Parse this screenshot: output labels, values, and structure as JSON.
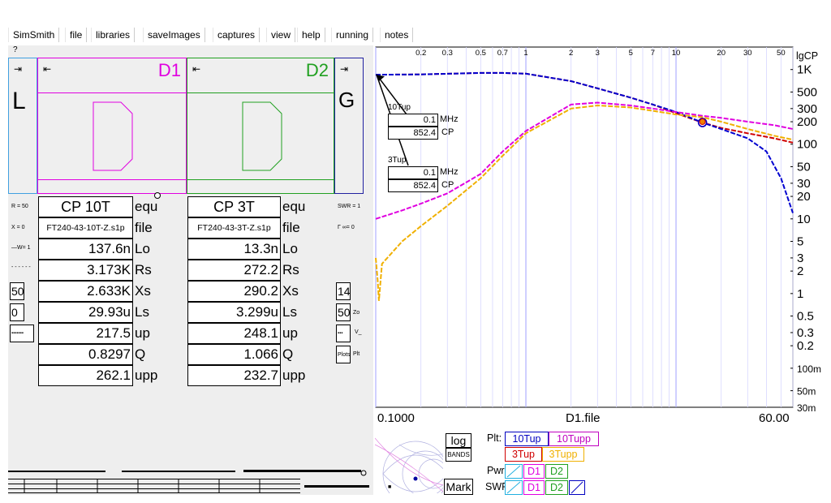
{
  "menu": [
    "SimSmith",
    "file",
    "libraries",
    "saveImages",
    "captures",
    "view",
    "help",
    "running",
    "notes"
  ],
  "help_mark": "?",
  "load": {
    "letter": "L",
    "arrow": "⇥"
  },
  "gen": {
    "letter": "G",
    "arrow": "⇥"
  },
  "d1": {
    "label": "D1",
    "arrow": "⇤",
    "color": "#e000e0"
  },
  "d2": {
    "label": "D2",
    "arrow": "⇤",
    "color": "#20a020"
  },
  "left_side": {
    "r": "R = 50",
    "x": "X = 0",
    "w": "—W= 1",
    "z_value": "50",
    "zero_value": "0"
  },
  "right_side": {
    "swr": "SWR = 1",
    "gamma": "Γ ∞= 0",
    "v14": "14",
    "zo_value": "50",
    "zo": "Zo",
    "v_label": "V_",
    "plots": "Plots",
    "plt": "Plt"
  },
  "table_units": [
    "equ",
    "file",
    "Lo",
    "Rs",
    "Xs",
    "Ls",
    "up",
    "Q",
    "upp"
  ],
  "col1": {
    "title": "CP 10T",
    "file": "FT240-43-10T-Z.s1p",
    "values": [
      "137.6n",
      "3.173K",
      "2.633K",
      "29.93u",
      "217.5",
      "0.8297",
      "262.1"
    ]
  },
  "col2": {
    "title": "CP 3T",
    "file": "FT240-43-3T-Z.s1p",
    "values": [
      "13.3n",
      "272.2",
      "290.2",
      "3.299u",
      "248.1",
      "1.066",
      "232.7"
    ]
  },
  "markers": [
    {
      "name": "10Tup",
      "freq": "0.1",
      "freq_unit": "MHz",
      "val": "852.4",
      "val_unit": "CP"
    },
    {
      "name": "3Tup",
      "freq": "0.1",
      "freq_unit": "MHz",
      "val": "852.4",
      "val_unit": "CP"
    }
  ],
  "x_axis": {
    "left": "0.1000",
    "center": "D1.file",
    "right": "60.00"
  },
  "controls": {
    "log": "log",
    "bands": "BANDS",
    "mark": "Mark",
    "plt": "Plt:",
    "pwr": "Pwr:",
    "swr": "SWR:"
  },
  "plot_buttons": {
    "b10tup": "10Tup",
    "b10tupp": "10Tupp",
    "b3tup": "3Tup",
    "b3tupp": "3Tupp",
    "d1": "D1",
    "d2": "D2"
  },
  "chart_data": {
    "type": "line",
    "xscale": "log",
    "xlim": [
      0.1,
      60
    ],
    "yscale": "log",
    "ylim": [
      0.03,
      2000
    ],
    "ylabel": "lgCP",
    "x_ticks": [
      "0.2",
      "0.3",
      "0.5",
      "0.7",
      "1",
      "2",
      "3",
      "5",
      "7",
      "10",
      "20",
      "30",
      "50"
    ],
    "y_ticks": [
      "1K",
      "500",
      "300",
      "200",
      "100",
      "50",
      "30",
      "20",
      "10",
      "5",
      "3",
      "2",
      "1",
      "0.5",
      "0.3",
      "0.2",
      "100m",
      "50m",
      "30m"
    ],
    "grid": true,
    "series": [
      {
        "name": "10Tup",
        "color": "#d00000",
        "x": [
          0.1,
          0.2,
          0.5,
          0.7,
          1,
          2,
          3,
          5,
          7,
          10,
          15,
          20,
          30,
          45,
          60
        ],
        "y": [
          852,
          860,
          900,
          900,
          880,
          700,
          560,
          420,
          340,
          260,
          195,
          165,
          140,
          120,
          105
        ]
      },
      {
        "name": "3Tup",
        "color": "#0000d0",
        "x": [
          0.1,
          0.2,
          0.5,
          0.7,
          1,
          2,
          3,
          5,
          7,
          10,
          15,
          20,
          30,
          40,
          50,
          60
        ],
        "y": [
          852,
          860,
          900,
          900,
          880,
          700,
          560,
          420,
          340,
          270,
          195,
          160,
          120,
          80,
          35,
          12
        ]
      },
      {
        "name": "10Tupp",
        "color": "#e000e0",
        "x": [
          0.1,
          0.15,
          0.2,
          0.3,
          0.5,
          0.7,
          1,
          2,
          3,
          5,
          7,
          10,
          15,
          20,
          30,
          45,
          60
        ],
        "y": [
          10,
          13,
          16,
          22,
          40,
          80,
          150,
          340,
          360,
          330,
          300,
          270,
          240,
          225,
          200,
          180,
          160
        ]
      },
      {
        "name": "3Tupp",
        "color": "#f0b000",
        "x": [
          0.1,
          0.103,
          0.105,
          0.11,
          0.15,
          0.2,
          0.3,
          0.5,
          0.7,
          1,
          2,
          3,
          5,
          7,
          10,
          15,
          20,
          30,
          45,
          60
        ],
        "y": [
          3,
          1.5,
          0.8,
          2.5,
          5,
          8,
          15,
          35,
          70,
          140,
          300,
          330,
          310,
          280,
          250,
          230,
          200,
          160,
          130,
          115
        ]
      }
    ],
    "marker_x": 15
  }
}
